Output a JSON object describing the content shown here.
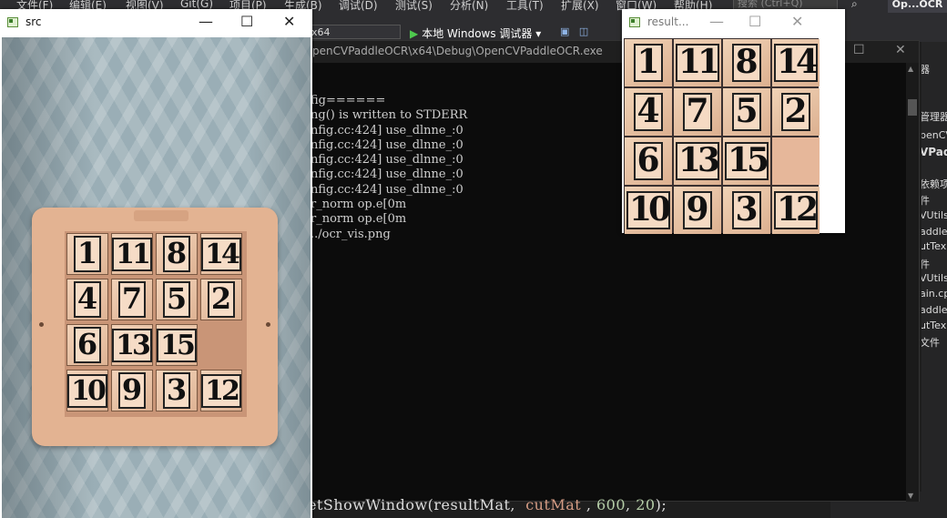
{
  "menubar": {
    "items": [
      "文件(F)",
      "编辑(E)",
      "视图(V)",
      "Git(G)",
      "项目(P)",
      "生成(B)",
      "调试(D)",
      "测试(S)",
      "分析(N)",
      "工具(T)",
      "扩展(X)",
      "窗口(W)",
      "帮助(H)"
    ],
    "search_placeholder": "搜索 (Ctrl+Q)",
    "search_icon": "magnifier",
    "app_name": "Op...OCR"
  },
  "toolbar": {
    "platform_combo": "x64",
    "run_label": "本地 Windows 调试器",
    "run_icon": "▶"
  },
  "console": {
    "title": "penCVPaddleOCR\\x64\\Debug\\OpenCVPaddleOCR.exe",
    "lines": [
      "fig======",
      "ng() is written to STDERR",
      "nfig.cc:424] use_dlnne_:0",
      "nfig.cc:424] use_dlnne_:0",
      "nfig.cc:424] use_dlnne_:0",
      "nfig.cc:424] use_dlnne_:0",
      "nfig.cc:424] use_dlnne_:0",
      "r_norm op.e[0m",
      "r_norm op.e[0m",
      "../ocr_vis.png"
    ]
  },
  "code_line": {
    "before": "etShowWindow(resultMat,  ",
    "string": "cutMat",
    "middle": " , ",
    "n1": "600",
    "comma": ", ",
    "n2": "20",
    "end": ");"
  },
  "solution_explorer": {
    "items": [
      "器",
      "管理器",
      "penCV",
      "VPadd",
      "依赖项",
      "件",
      "VUtils",
      "addle",
      "utTex",
      "件",
      "VUtils",
      "ain.cp",
      "addle",
      "utTex",
      "文件"
    ]
  },
  "src_window": {
    "title": "src",
    "tiles": [
      [
        "1",
        "11",
        "8",
        "14"
      ],
      [
        "4",
        "7",
        "5",
        "2"
      ],
      [
        "6",
        "13",
        "15",
        ""
      ],
      [
        "10",
        "9",
        "3",
        "12"
      ]
    ]
  },
  "result_window": {
    "title": "result...",
    "tiles": [
      [
        "1",
        "11",
        "8",
        "14"
      ],
      [
        "4",
        "7",
        "5",
        "2"
      ],
      [
        "6",
        "13",
        "15",
        ""
      ],
      [
        "10",
        "9",
        "3",
        "12"
      ]
    ]
  },
  "colors": {
    "vs_bg": "#1e1e1e",
    "console_bg": "#0c0c0c",
    "tile": "#e8c2a4",
    "run_green": "#4ec94e"
  }
}
